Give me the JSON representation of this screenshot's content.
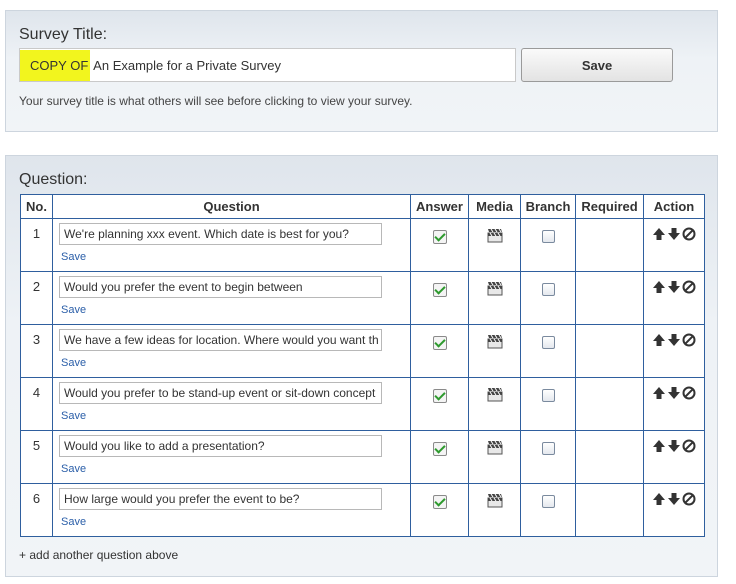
{
  "survey_title": {
    "heading": "Survey Title:",
    "highlight_prefix": "COPY OF",
    "title_rest": " An Example for a Private Survey",
    "save_label": "Save",
    "help_text": "Your survey title is what others will see before clicking to view your survey."
  },
  "questions_panel": {
    "heading": "Question:",
    "columns": [
      "No.",
      "Question",
      "Answer",
      "Media",
      "Branch",
      "Required",
      "Action"
    ],
    "rows": [
      {
        "no": "1",
        "text": "We're planning xxx event. Which date is best for you?",
        "save": "Save",
        "answer": true,
        "branch": false
      },
      {
        "no": "2",
        "text": "Would you prefer the event to begin between",
        "save": "Save",
        "answer": true,
        "branch": false
      },
      {
        "no": "3",
        "text": "We have a few ideas for location. Where would you want th",
        "save": "Save",
        "answer": true,
        "branch": false
      },
      {
        "no": "4",
        "text": "Would you prefer to be stand-up event or sit-down concept",
        "save": "Save",
        "answer": true,
        "branch": false
      },
      {
        "no": "5",
        "text": "Would you like to add a presentation?",
        "save": "Save",
        "answer": true,
        "branch": false
      },
      {
        "no": "6",
        "text": "How large would you prefer the event to be?",
        "save": "Save",
        "answer": true,
        "branch": false
      }
    ],
    "add_link": "+ add another question above"
  },
  "icons": {
    "answer": "green-check-icon",
    "media": "clapperboard-icon",
    "action": [
      "arrow-up-icon",
      "arrow-down-icon",
      "delete-circle-icon"
    ]
  },
  "colors": {
    "highlight": "#f2f51e",
    "table_border": "#2f5f9e",
    "link": "#2a5ea8",
    "check": "#2e9a2e"
  }
}
